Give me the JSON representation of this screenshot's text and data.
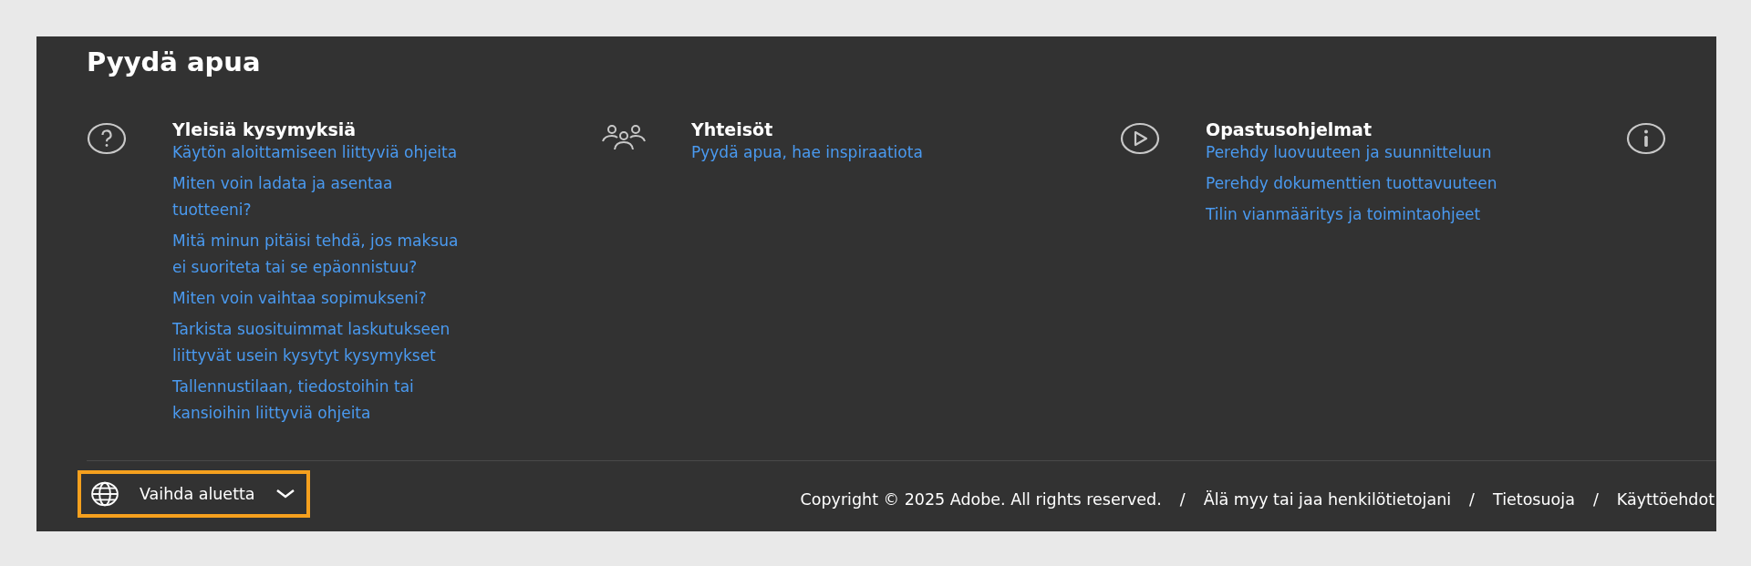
{
  "title": "Pyydä apua",
  "columns": [
    {
      "heading": "Yleisiä kysymyksiä",
      "links": [
        "Käytön aloittamiseen liittyviä ohjeita",
        "Miten voin ladata ja asentaa tuotteeni?",
        "Mitä minun pitäisi tehdä, jos maksua ei suoriteta tai se epäonnistuu?",
        "Miten voin vaihtaa sopimukseni?",
        "Tarkista suosituimmat laskutukseen liittyvät usein kysytyt kysymykset",
        "Tallennustilaan, tiedostoihin tai kansioihin liittyviä ohjeita"
      ]
    },
    {
      "heading": "Yhteisöt",
      "links": [
        "Pyydä apua, hae inspiraatiota"
      ]
    },
    {
      "heading": "Opastusohjelmat",
      "links": [
        "Perehdy luovuuteen ja suunnitteluun",
        "Perehdy dokumenttien tuottavuuteen",
        "Tilin vianmääritys ja toimintaohjeet"
      ]
    }
  ],
  "region_button": {
    "label": "Vaihda aluetta",
    "highlighted": true
  },
  "copyright": "Copyright © 2025 Adobe. All rights reserved.",
  "footer_links": [
    {
      "separator": "/",
      "label": "Älä myy tai jaa henkilötietojani"
    },
    {
      "separator": "/",
      "label": "Tietosuoja"
    },
    {
      "separator": "/",
      "label": "Käyttöehdot"
    }
  ]
}
